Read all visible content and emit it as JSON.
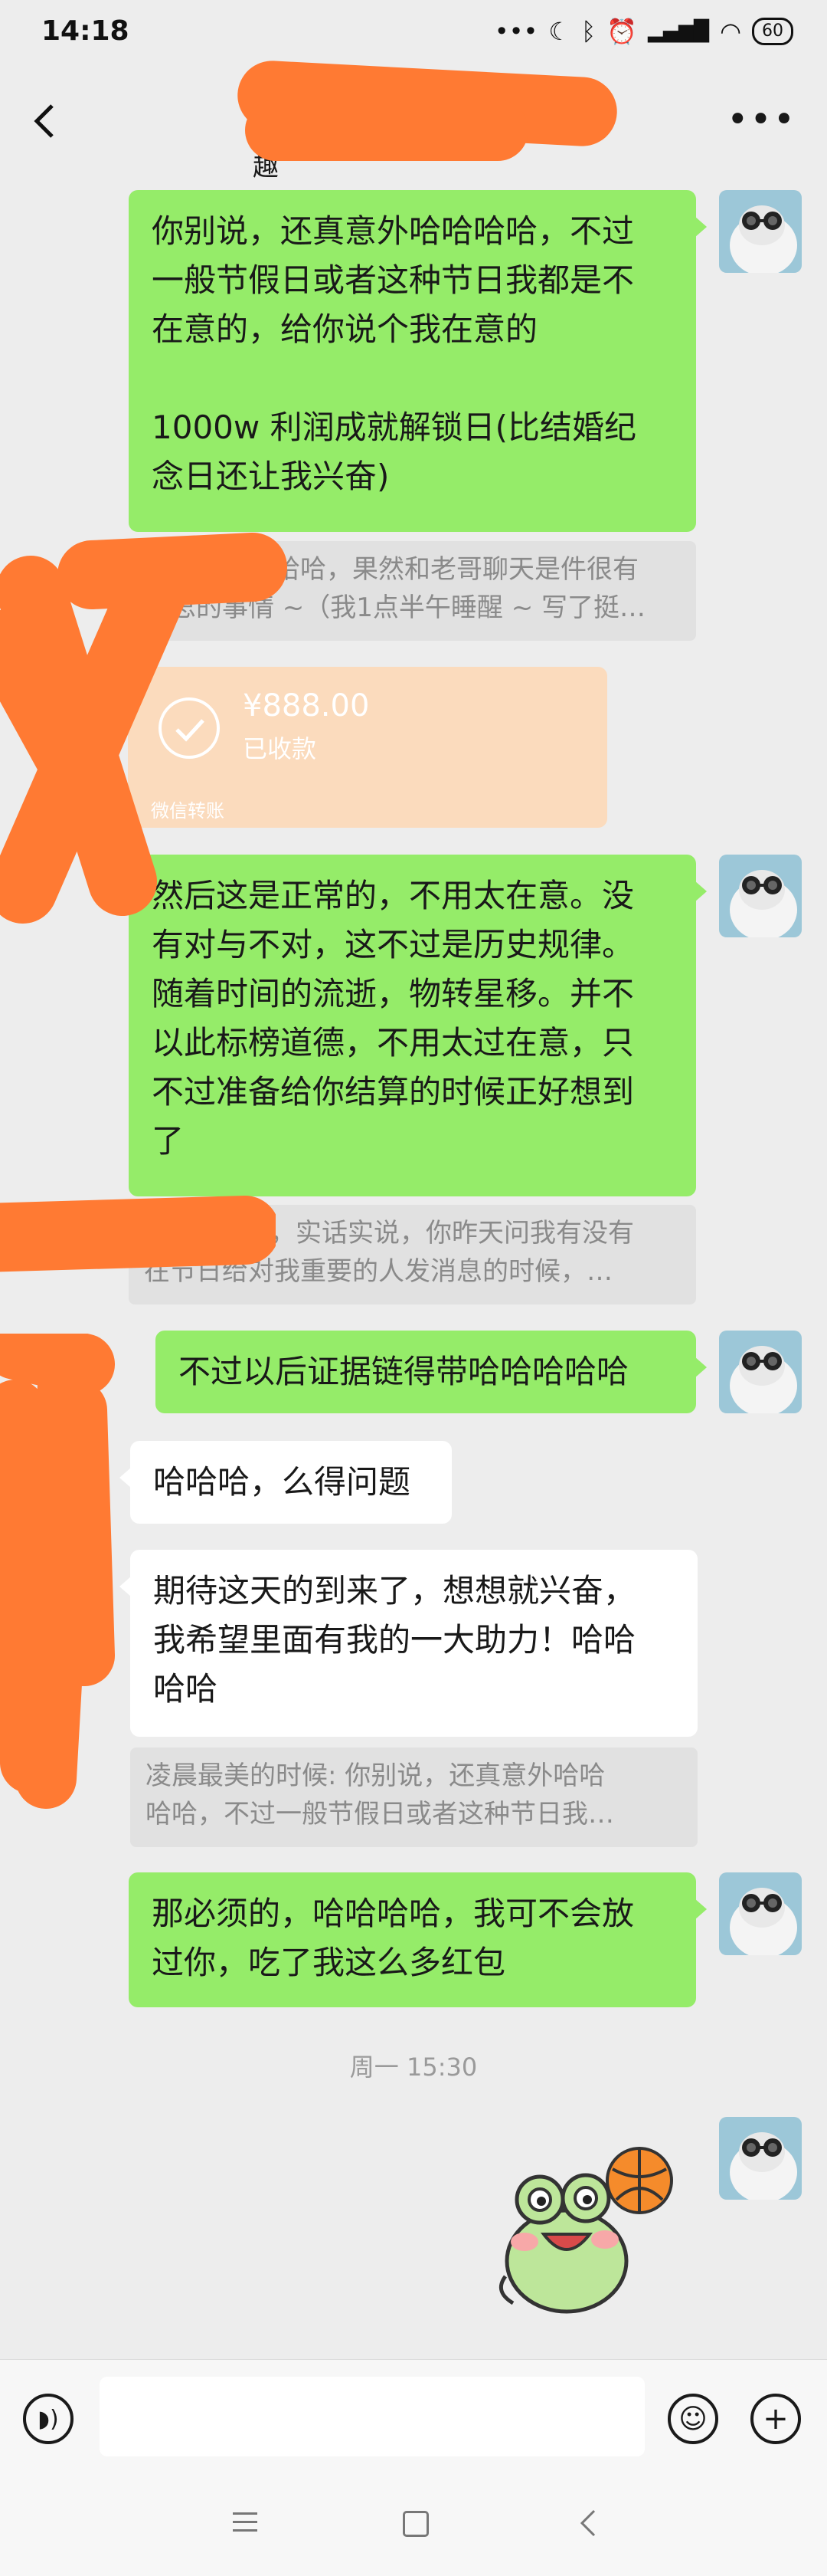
{
  "status_bar": {
    "time": "14:18",
    "dots": "•••",
    "battery": "60"
  },
  "nav": {
    "title_visible": "趣",
    "more": "•••"
  },
  "messages": [
    {
      "side": "right",
      "lines": [
        "你别说，还真意外哈哈哈哈，不过",
        "一般节假日或者这种节日我都是不",
        "在意的，给你说个我在意的",
        "",
        "1000w 利润成就解锁日(比结婚纪",
        "念日还让我兴奋)"
      ]
    }
  ],
  "quote1": {
    "line1": "哈哈，果然和老哥聊天是件很有",
    "line2": "意思的事情 ~（我1点半午睡醒 ~ 写了挺…"
  },
  "transfer": {
    "amount": "¥888.00",
    "status": "已收款",
    "footer": "微信转账"
  },
  "msg2": [
    "然后这是正常的，不用太在意。没",
    "有对与不对，这不过是历史规律。",
    "随着时间的流逝，物转星移。并不",
    "以此标榜道德，不用太过在意，只",
    "不过准备给你结算的时候正好想到",
    "了"
  ],
  "quote2": {
    "line1": "人，实话实说，你昨天问我有没有",
    "line2": "在节日给对我重要的人发消息的时候，…"
  },
  "msg3": "不过以后证据链得带哈哈哈哈哈",
  "msg4": "哈哈哈，么得问题",
  "msg5": [
    "期待这天的到来了，想想就兴奋，",
    "我希望里面有我的一大助力！哈哈",
    "哈哈"
  ],
  "quote3": {
    "line1": "凌晨最美的时候: 你别说，还真意外哈哈",
    "line2": "哈哈，不过一般节假日或者这种节日我…"
  },
  "msg6": [
    "那必须的，哈哈哈哈，我可不会放",
    "过你，吃了我这么多红包"
  ],
  "timestamp": "周一 15:30",
  "colors": {
    "green_bubble": "#95ec69",
    "redaction": "#ff7a33",
    "transfer": "#fbdbbd"
  }
}
